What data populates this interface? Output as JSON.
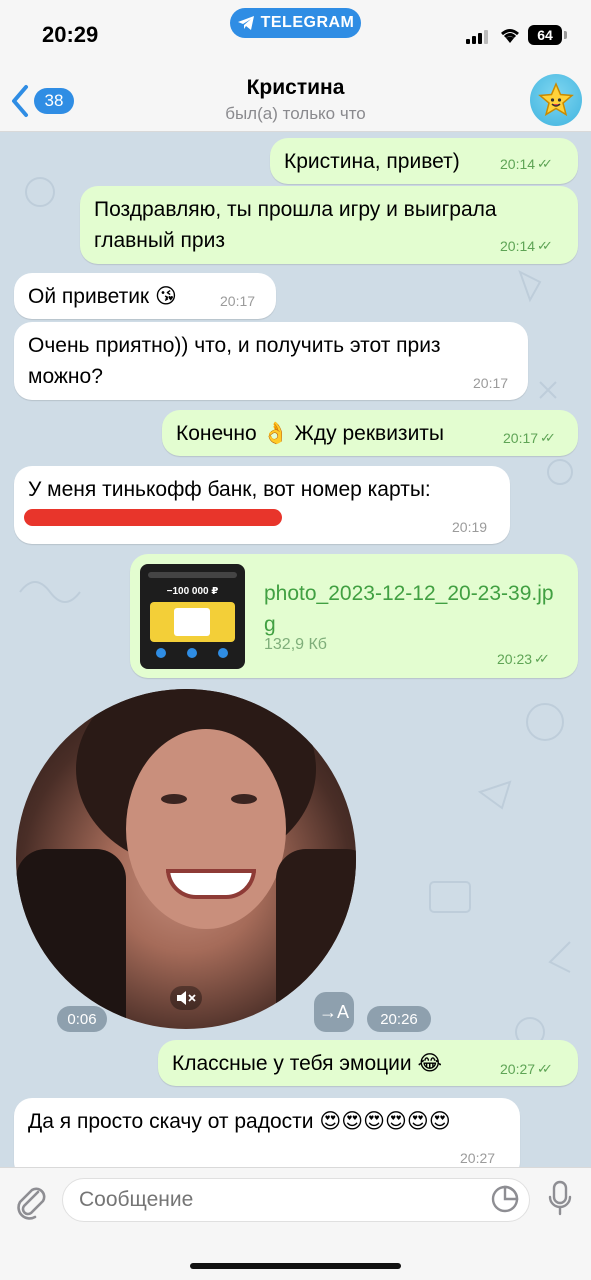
{
  "status_bar": {
    "time": "20:29",
    "app_pill": "TELEGRAM",
    "battery": "64"
  },
  "header": {
    "back_count": "38",
    "contact_name": "Кристина",
    "contact_status": "был(а) только что"
  },
  "messages": [
    {
      "dir": "out",
      "text": "Кристина, привет)",
      "time": "20:14"
    },
    {
      "dir": "out",
      "text": "Поздравляю, ты прошла игру и выиграла главный приз",
      "time": "20:14"
    },
    {
      "dir": "in",
      "text": "Ой приветик 😘",
      "time": "20:17"
    },
    {
      "dir": "in",
      "text": "Очень приятно)) что, и получить этот приз можно?",
      "time": "20:17"
    },
    {
      "dir": "out",
      "text": "Конечно 👌 Жду реквизиты",
      "time": "20:17"
    },
    {
      "dir": "in",
      "text": "У меня тинькофф банк, вот номер карты:",
      "time": "20:19"
    },
    {
      "dir": "out",
      "type": "file",
      "file_name": "photo_2023-12-12_20-23-39.jpg",
      "file_size": "132,9 Кб",
      "time": "20:23"
    },
    {
      "dir": "in",
      "type": "video",
      "duration": "0:06",
      "translate": "→A",
      "time": "20:26"
    },
    {
      "dir": "out",
      "text": "Классные у тебя эмоции 😂",
      "time": "20:27"
    },
    {
      "dir": "in",
      "text": "Да я просто скачу от радости 😍😍😍😍😍😍",
      "time": "20:27"
    }
  ],
  "thumb": {
    "amount": "−100 000 ₽"
  },
  "input": {
    "placeholder": "Сообщение"
  },
  "colors": {
    "accent": "#2f8de4",
    "out_bubble": "#e3fdd0",
    "in_bubble": "#ffffff",
    "chat_bg": "#cfdce6",
    "redact": "#e8352b"
  },
  "icons": [
    "telegram-icon",
    "signal-icon",
    "wifi-icon",
    "back-chevron-icon",
    "star-avatar-icon",
    "attach-icon",
    "sticker-icon",
    "mic-icon",
    "muted-speaker-icon",
    "double-check-icon"
  ]
}
